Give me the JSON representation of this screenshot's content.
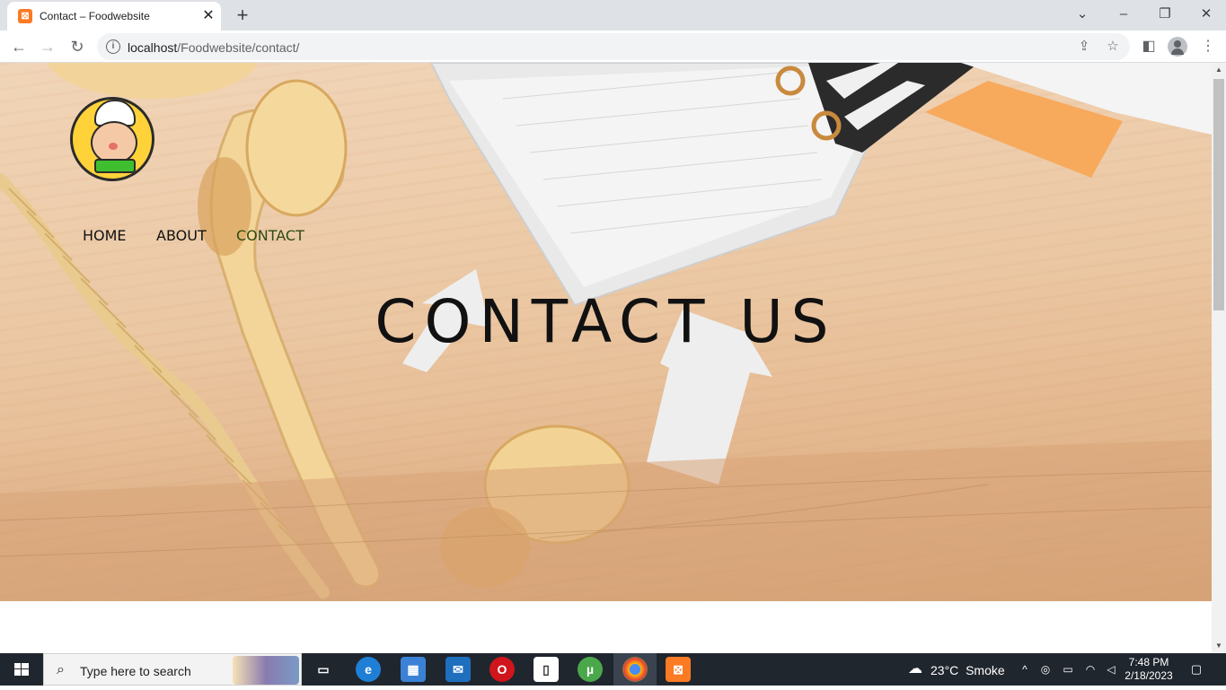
{
  "browser": {
    "tab_title": "Contact – Foodwebsite",
    "tab_favicon": "xampp-icon",
    "url_host": "localhost",
    "url_path": "/Foodwebsite/contact/"
  },
  "page": {
    "logo_alt": "chef-logo",
    "nav": [
      {
        "label": "HOME",
        "active": false
      },
      {
        "label": "ABOUT",
        "active": false
      },
      {
        "label": "CONTACT",
        "active": true
      }
    ],
    "hero_title": "CONTACT US"
  },
  "taskbar": {
    "search_placeholder": "Type here to search",
    "weather_temp": "23°C",
    "weather_label": "Smoke",
    "time": "7:48 PM",
    "date": "2/18/2023"
  },
  "colors": {
    "nav_active": "#2f4a14",
    "taskbar_bg": "#20262e",
    "tab_strip": "#dee1e6"
  }
}
